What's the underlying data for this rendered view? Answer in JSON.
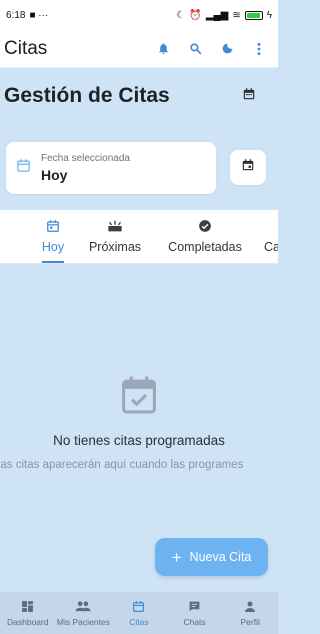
{
  "status_bar": {
    "time": "6:18",
    "extra": "■ ···",
    "battery": "100"
  },
  "app_bar": {
    "title": "Citas"
  },
  "section": {
    "title": "Gestión de Citas"
  },
  "date_selector": {
    "label": "Fecha seleccionada",
    "value": "Hoy"
  },
  "tabs": [
    {
      "label": "Hoy",
      "icon": "calendar-today-icon",
      "active": true
    },
    {
      "label": "Próximas",
      "icon": "upcoming-icon",
      "active": false
    },
    {
      "label": "Completadas",
      "icon": "check-circle-icon",
      "active": false
    },
    {
      "label": "Ca",
      "icon": "cancel-icon",
      "active": false
    }
  ],
  "empty": {
    "title": "No tienes citas programadas",
    "subtitle": "Las citas aparecerán aquí cuando las programes"
  },
  "fab": {
    "label": "Nueva Cita"
  },
  "bottom_nav": [
    {
      "label": "Dashboard",
      "icon": "dashboard-icon",
      "active": false
    },
    {
      "label": "Mis Pacientes",
      "icon": "people-icon",
      "active": false
    },
    {
      "label": "Citas",
      "icon": "calendar-icon",
      "active": true
    },
    {
      "label": "Chats",
      "icon": "chat-icon",
      "active": false
    },
    {
      "label": "Perfil",
      "icon": "person-icon",
      "active": false
    }
  ],
  "colors": {
    "accent": "#3d8bd7",
    "background": "#cfe3f6",
    "fab": "#6db3f2",
    "bottom_nav": "#c3d6ea"
  }
}
